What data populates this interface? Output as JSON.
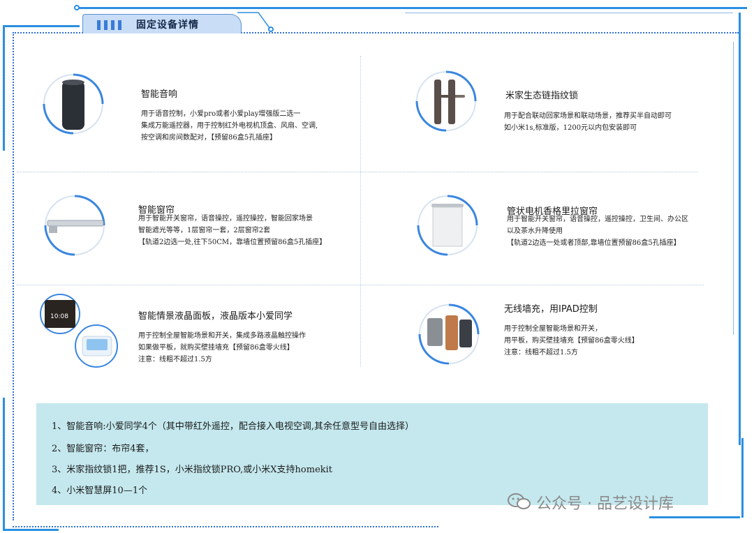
{
  "header": {
    "title": "固定设备详情"
  },
  "devices": [
    {
      "title": "智能音响",
      "desc": "用于语音控制，小爱pro或者小爱play增强版二选一\n集成万能遥控器，用于控制红外电视机顶盒、风扇、空调,\n按空调和房间数配对，【预留86盒5孔插座】",
      "icon": "smart-speaker-icon"
    },
    {
      "title": "米家生态链指纹锁",
      "desc": "用于配合联动回家场景和联动场景，推荐买半自动即可\n如小米1s,标准版，1200元以内包安装即可",
      "icon": "fingerprint-lock-icon"
    },
    {
      "title": "智能窗帘",
      "desc": "用于智能开关窗帘，语音操控，遥控操控，智能回家场景\n智能遮光等等，1层窗帘一套，2层窗帘2套\n【轨道2边选一处,往下50CM，靠墙位置预留86盒5孔插座】",
      "icon": "curtain-track-icon"
    },
    {
      "title": "管状电机香格里拉窗帘",
      "desc": "用于智能开关窗帘，语音操控，遥控操控，卫生间、办公区\n以及茶水升降使用\n【轨道2边选一处或者顶部,靠墙位置预留86盒5孔插座】",
      "icon": "roller-blind-icon"
    },
    {
      "title": "智能情景液晶面板，液晶版本小爱同学",
      "desc": "用于控制全屋智能场景和开关，集成多路液晶触控操作\n如果做平板，就购买壁挂墙充【预留86盒零火线】\n注意：线粗不超过1.5方",
      "icon": "lcd-panel-icon",
      "panel_time": "10:08"
    },
    {
      "title": "无线墙充，用IPAD控制",
      "desc": "用于控制全屋智能场景和开关，\n用平板，购买壁挂墙充【预留86盒零火线】\n注意：线粗不超过1.5方",
      "icon": "wall-charger-icon"
    }
  ],
  "summary": {
    "items": [
      "1、智能音响:小爱同学4个（其中带红外遥控，配合接入电视空调,其余任意型号自由选择）",
      "2、智能窗帘：布帘4套，",
      "3、米家指纹锁1把，推荐1S，小米指纹锁PRO,或小米X支持homekit",
      "4、小米智慧屏10—1个"
    ]
  },
  "watermark": {
    "text": "公众号 · 品艺设计库",
    "icon": "wechat-icon"
  },
  "colors": {
    "accent": "#2a8fe0",
    "summary_bg": "#c4e8ee",
    "tab_bg": "#c9def6"
  }
}
